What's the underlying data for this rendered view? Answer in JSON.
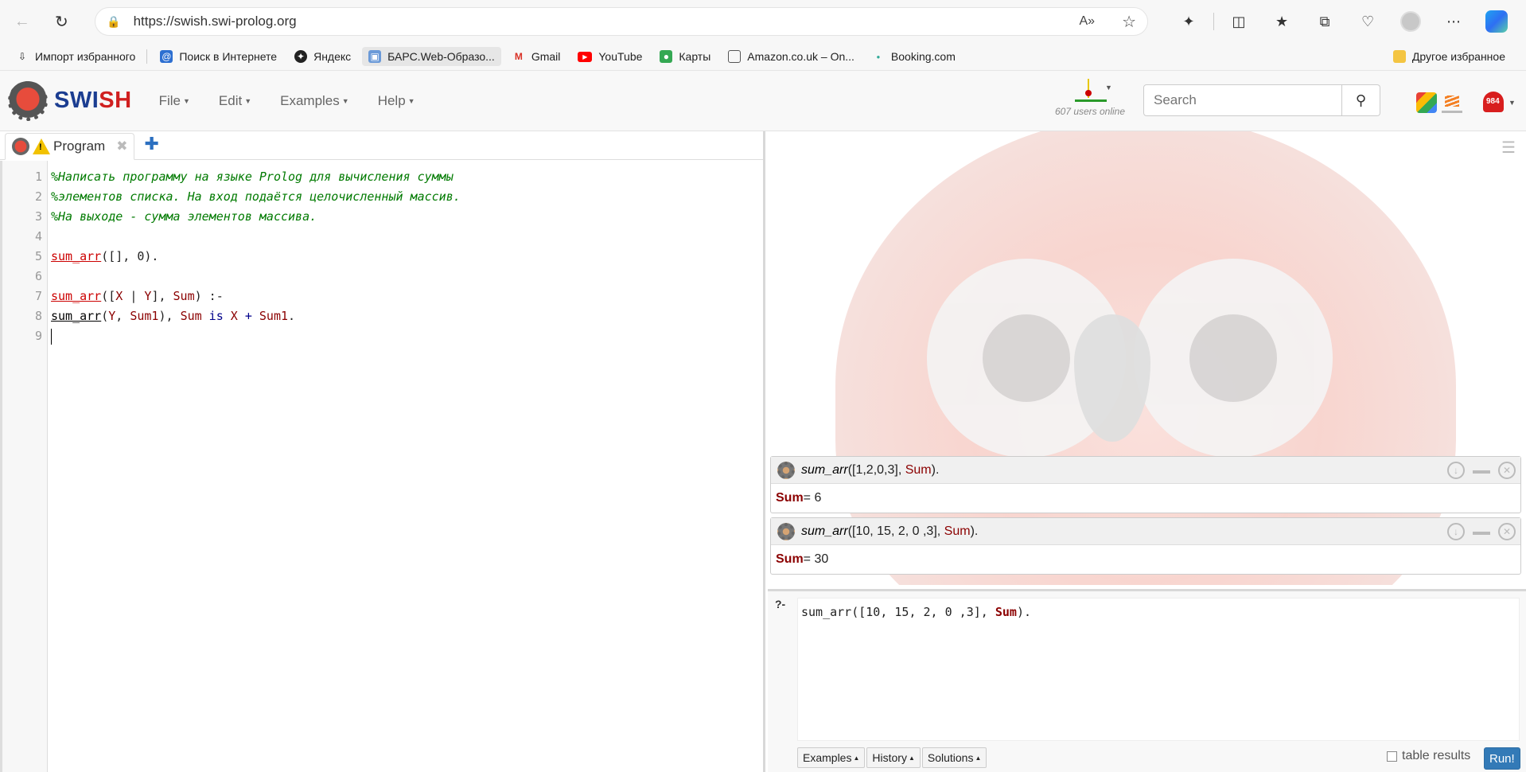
{
  "browser": {
    "url": "https://swish.swi-prolog.org",
    "read_aloud": "A»"
  },
  "bookmarks": {
    "items": [
      {
        "label": "Импорт избранного",
        "icon": "import-icon"
      },
      {
        "label": "Поиск в Интернете",
        "icon": "mail-at-icon"
      },
      {
        "label": "Яндекс",
        "icon": "yandex-icon"
      },
      {
        "label": "БАРС.Web-Образо...",
        "icon": "bars-icon"
      },
      {
        "label": "Gmail",
        "icon": "gmail-icon"
      },
      {
        "label": "YouTube",
        "icon": "youtube-icon"
      },
      {
        "label": "Карты",
        "icon": "maps-icon"
      },
      {
        "label": "Amazon.co.uk – On...",
        "icon": "page-icon"
      },
      {
        "label": "Booking.com",
        "icon": "booking-icon"
      }
    ],
    "other": "Другое избранное"
  },
  "swish": {
    "logo_a": "SWI",
    "logo_b": "SH",
    "menu": [
      "File",
      "Edit",
      "Examples",
      "Help"
    ],
    "users_online": "607 users online",
    "search_placeholder": "Search",
    "notification_count": "984"
  },
  "editor": {
    "tab_label": "Program",
    "line_numbers": [
      "1",
      "2",
      "3",
      "4",
      "5",
      "6",
      "7",
      "8",
      "9"
    ],
    "comments": [
      "%Написать программу на языке Prolog для вычисления суммы",
      "%элементов списка. На вход подаётся целочисленный массив.",
      "%На выходе - сумма элементов массива."
    ],
    "line5": {
      "head": "sum_arr",
      "rest": "([], 0)."
    },
    "line7": {
      "head": "sum_arr",
      "p1": "([",
      "x": "X",
      "p2": " | ",
      "y": "Y",
      "p3": "], ",
      "sum": "Sum",
      "p4": ") :-"
    },
    "line8": {
      "call": "sum_arr",
      "p1": "(",
      "y": "Y",
      "p2": ", ",
      "sum1": "Sum1",
      "p3": "), ",
      "sum": "Sum",
      "is": " is ",
      "x": "X",
      "plus": " + ",
      "sum1b": "Sum1",
      "end": "."
    }
  },
  "answers": [
    {
      "pred": "sum_arr",
      "args": "([1,2,0,3], ",
      "var": "Sum",
      "close": ").",
      "res_var": "Sum",
      "res_val": " = 6"
    },
    {
      "pred": "sum_arr",
      "args": "([10, 15, 2, 0 ,3], ",
      "var": "Sum",
      "close": ").",
      "res_var": "Sum",
      "res_val": " = 30"
    }
  ],
  "query": {
    "prompt": "?-",
    "pre": "sum_arr([10, 15, 2, 0 ,3], ",
    "var": "Sum",
    "post": ").",
    "buttons": [
      "Examples",
      "History",
      "Solutions"
    ],
    "table_results": "table results",
    "run": "Run!"
  }
}
